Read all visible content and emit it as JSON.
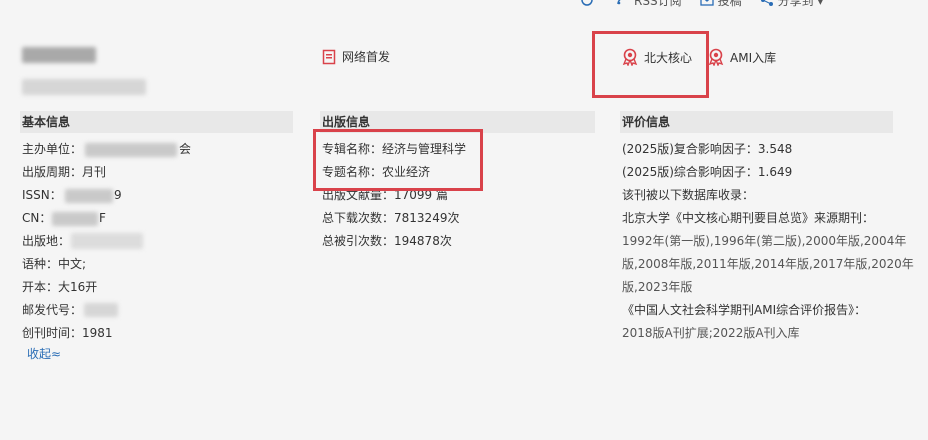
{
  "topbar": {
    "items": [
      {
        "label": "",
        "icon": "share-circle-icon"
      },
      {
        "label": "RSS订阅",
        "icon": "rss-icon"
      },
      {
        "label": "投稿",
        "icon": "mail-icon"
      },
      {
        "label": "分享到 ▾",
        "icon": "share-icon"
      }
    ]
  },
  "badges": {
    "first_publish": "网络首发",
    "pku_core": "北大核心",
    "ami": "AMI入库"
  },
  "basic": {
    "title": "基本信息",
    "sponsor_label": "主办单位：",
    "sponsor_suffix": "会",
    "period_label": "出版周期：",
    "period_value": "月刊",
    "issn_label": "ISSN：",
    "issn_suffix": "9",
    "cn_label": "CN：",
    "cn_suffix": "F",
    "place_label": "出版地：",
    "lang_label": "语种：",
    "lang_value": "中文;",
    "format_label": "开本：",
    "format_value": "大16开",
    "postcode_label": "邮发代号：",
    "founded_label": "创刊时间：",
    "founded_value": "1981",
    "collapse": "收起≈"
  },
  "publish": {
    "title": "出版信息",
    "series_label": "专辑名称：",
    "series_value": "经济与管理科学",
    "topic_label": "专题名称：",
    "topic_value": "农业经济",
    "docs_label": "出版文献量：",
    "docs_value": "17099 篇",
    "downloads_label": "总下载次数：",
    "downloads_value": "7813249次",
    "cited_label": "总被引次数：",
    "cited_value": "194878次"
  },
  "evaluation": {
    "title": "评价信息",
    "lines": [
      "(2025版)复合影响因子：3.548",
      "(2025版)综合影响因子：1.649",
      "该刊被以下数据库收录：",
      "北京大学《中文核心期刊要目总览》来源期刊：",
      "1992年(第一版),1996年(第二版),2000年版,2004年",
      "版,2008年版,2011年版,2014年版,2017年版,2020年",
      "版,2023年版",
      "《中国人文社会科学期刊AMI综合评价报告》：",
      "2018版A刊扩展;2022版A刊入库"
    ]
  },
  "colors": {
    "highlight": "#d9424a",
    "link": "#2a6db5",
    "section_bg": "#e8e8e8"
  }
}
